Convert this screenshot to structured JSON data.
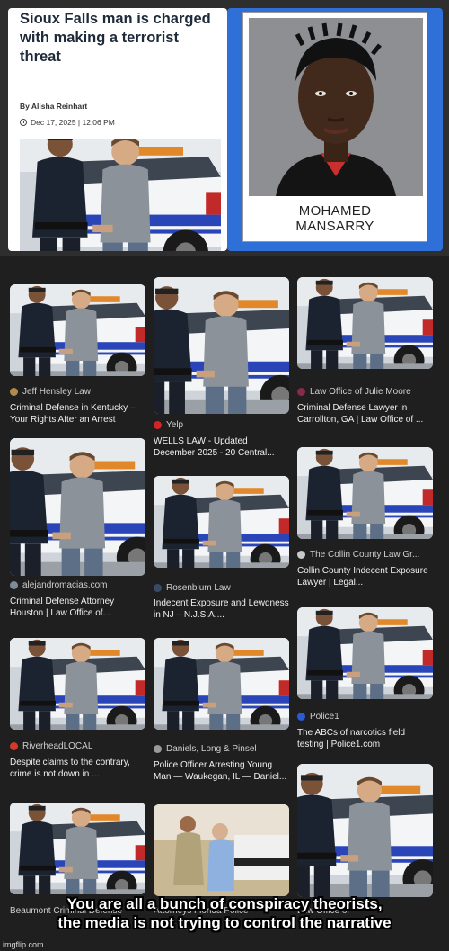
{
  "article": {
    "title": "Sioux Falls man is charged with making a terrorist threat",
    "byline": "By Alisha Reinhart",
    "date": "Dec 17, 2025 | 12:06 PM"
  },
  "mugshot": {
    "name_line1": "MOHAMED",
    "name_line2": "MANSARRY"
  },
  "colors": {
    "background": "#1f1f1f",
    "mug_panel": "#2f6fd8",
    "caption_text": "#f0f0f0",
    "source_text": "#cfcfcf"
  },
  "results": [
    {
      "source": "Jeff Hensley Law",
      "caption": "Criminal Defense in Kentucky – Your Rights After an Arrest",
      "icon": "scales-icon"
    },
    {
      "source": "Yelp",
      "caption": "WELLS LAW - Updated December 2025 - 20 Central...",
      "icon": "yelp-icon"
    },
    {
      "source": "Law Office of Julie Moore",
      "caption": "Criminal Defense Lawyer in Carrollton, GA | Law Office of ...",
      "icon": "law-icon"
    },
    {
      "source": "alejandromacias.com",
      "caption": "Criminal Defense Attorney Houston | Law Office of...",
      "icon": "globe-icon"
    },
    {
      "source": "Rosenblum Law",
      "caption": "Indecent Exposure and Lewdness in NJ – N.J.S.A....",
      "icon": "r-icon"
    },
    {
      "source": "The Collin County Law Gr...",
      "caption": "Collin County Indecent Exposure Lawyer | Legal...",
      "icon": "gear-icon"
    },
    {
      "source": "Police1",
      "caption": "The ABCs of narcotics field testing | Police1.com",
      "icon": "p1-icon"
    },
    {
      "source": "RiverheadLOCAL",
      "caption": "Despite claims to the contrary, crime is not down in ...",
      "icon": "pin-icon"
    },
    {
      "source": "Daniels, Long & Pinsel",
      "caption": "Police Officer Arresting Young Man — Waukegan, IL — Daniel...",
      "icon": "scales-icon"
    }
  ],
  "partial": {
    "left": "Beaumont Criminal Defense",
    "middle": "Attorneys Florida Police",
    "right": "Law Office of"
  },
  "meme": {
    "line1": "You are all a bunch of conspiracy theorists,",
    "line2": "the media is not trying to control the narrative"
  },
  "watermark": "imgflip.com"
}
